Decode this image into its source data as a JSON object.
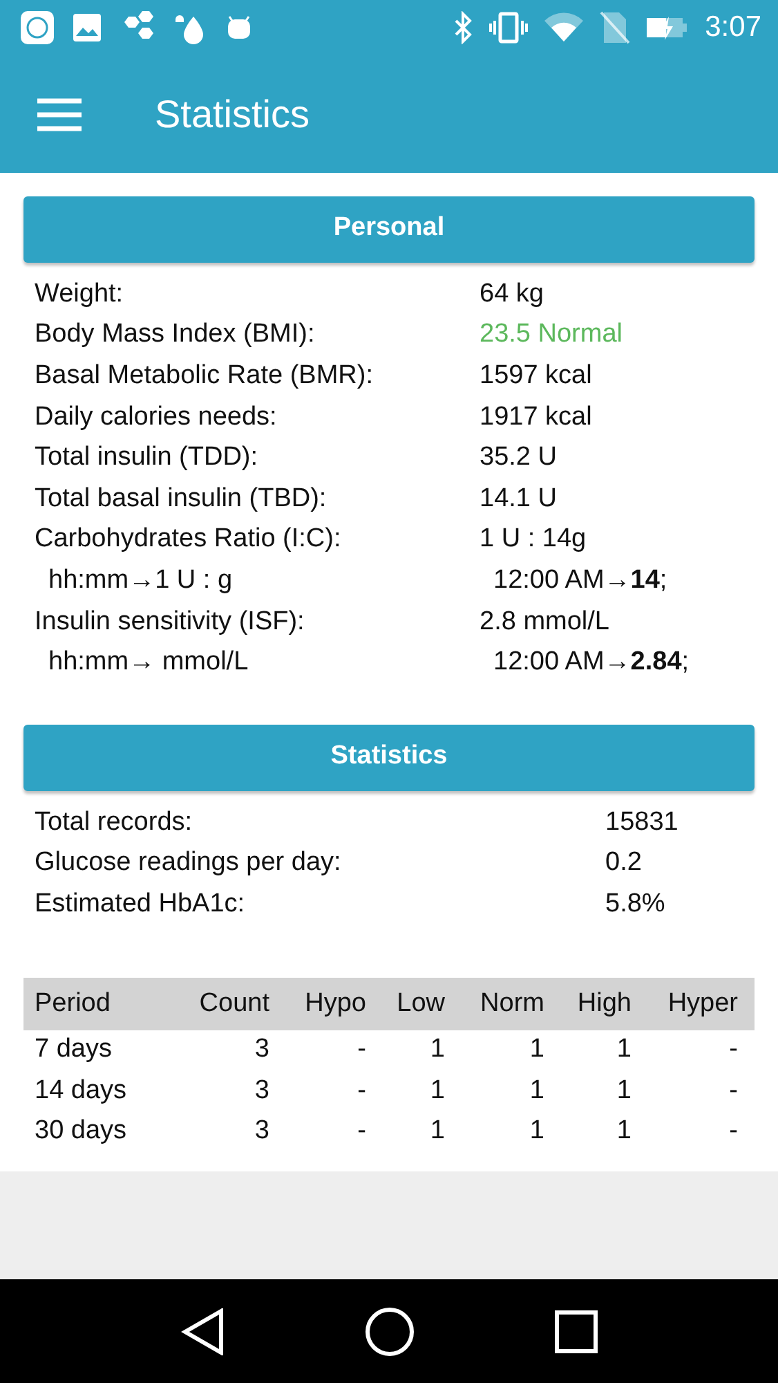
{
  "status_bar": {
    "time": "3:07"
  },
  "app_bar": {
    "title": "Statistics"
  },
  "personal": {
    "title": "Personal",
    "rows": [
      {
        "label": "Weight:",
        "value": "64 kg",
        "indent": false
      },
      {
        "label": "Body Mass Index (BMI):",
        "value": "23.5 Normal",
        "indent": false,
        "color": "#5cb85c"
      },
      {
        "label": "Basal Metabolic Rate (BMR):",
        "value": "1597 kcal",
        "indent": false
      },
      {
        "label": "Daily calories needs:",
        "value": "1917 kcal",
        "indent": false
      },
      {
        "label": "Total insulin (TDD):",
        "value": "35.2 U",
        "indent": false
      },
      {
        "label": "Total basal insulin (TBD):",
        "value": "14.1 U",
        "indent": false
      },
      {
        "label": "Carbohydrates Ratio (I:C):",
        "value": "1 U : 14g",
        "indent": false
      },
      {
        "label": "hh:mm→1 U : g",
        "value": "12:00 AM→**14**;",
        "indent": true
      },
      {
        "label": "Insulin sensitivity (ISF):",
        "value": "2.8 mmol/L",
        "indent": false
      },
      {
        "label": "hh:mm→ mmol/L",
        "value": "12:00 AM→**2.84**;",
        "indent": true
      }
    ]
  },
  "statistics": {
    "title": "Statistics",
    "rows": [
      {
        "label": "Total records:",
        "value": "15831"
      },
      {
        "label": "Glucose readings per day:",
        "value": "0.2"
      },
      {
        "label": "Estimated HbA1c:",
        "value": "5.8%"
      }
    ]
  },
  "table": {
    "columns": [
      "Period",
      "Count",
      "Hypo",
      "Low",
      "Norm",
      "High",
      "Hyper"
    ],
    "rows": [
      [
        "7 days",
        "3",
        "-",
        "1",
        "1",
        "1",
        "-"
      ],
      [
        "14 days",
        "3",
        "-",
        "1",
        "1",
        "1",
        "-"
      ],
      [
        "30 days",
        "3",
        "-",
        "1",
        "1",
        "1",
        "-"
      ]
    ]
  }
}
